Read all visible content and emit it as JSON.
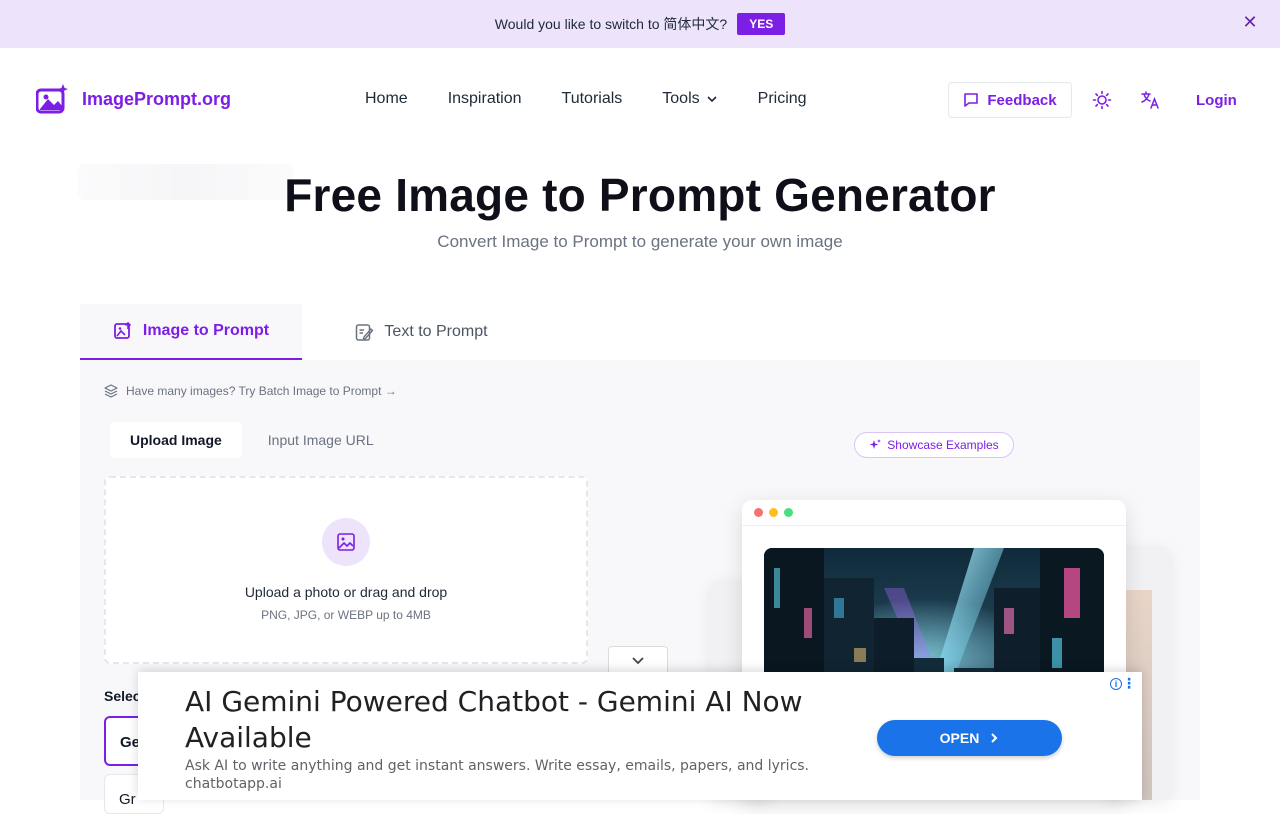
{
  "banner": {
    "message": "Would you like to switch to 简体中文?",
    "yes_label": "YES"
  },
  "header": {
    "logo_text": "ImagePrompt.org",
    "nav": {
      "home": "Home",
      "inspiration": "Inspiration",
      "tutorials": "Tutorials",
      "tools": "Tools",
      "pricing": "Pricing"
    },
    "feedback_label": "Feedback",
    "login_label": "Login"
  },
  "hero": {
    "title": "Free Image to Prompt Generator",
    "subtitle": "Convert Image to Prompt to generate your own image"
  },
  "tabs": {
    "image_to_prompt": "Image to Prompt",
    "text_to_prompt": "Text to Prompt"
  },
  "panel": {
    "batch_hint": "Have many images? Try Batch Image to Prompt →",
    "subtabs": {
      "upload": "Upload Image",
      "url": "Input Image URL"
    },
    "dropzone": {
      "title": "Upload a photo or drag and drop",
      "hint": "PNG, JPG, or WEBP up to 4MB"
    },
    "select_label": "Selec",
    "options": [
      "Ge",
      "Gr"
    ],
    "showcase_label": "Showcase Examples"
  },
  "ad": {
    "headline": "AI Gemini Powered Chatbot - Gemini AI Now Available",
    "description": "Ask AI to write anything and get instant answers. Write essay, emails, papers, and lyrics.",
    "domain": "chatbotapp.ai",
    "cta": "OPEN"
  },
  "colors": {
    "accent": "#7c1ee6",
    "banner_bg": "#ede3fb",
    "ad_button": "#1a73e8"
  },
  "icons": [
    "close-icon",
    "logo-icon",
    "chevron-down-icon",
    "message-icon",
    "sun-icon",
    "translate-icon",
    "image-upload-icon",
    "edit-note-icon",
    "layers-icon",
    "image-icon",
    "sparkle-icon",
    "info-icon",
    "more-icon",
    "chevron-right-icon"
  ]
}
